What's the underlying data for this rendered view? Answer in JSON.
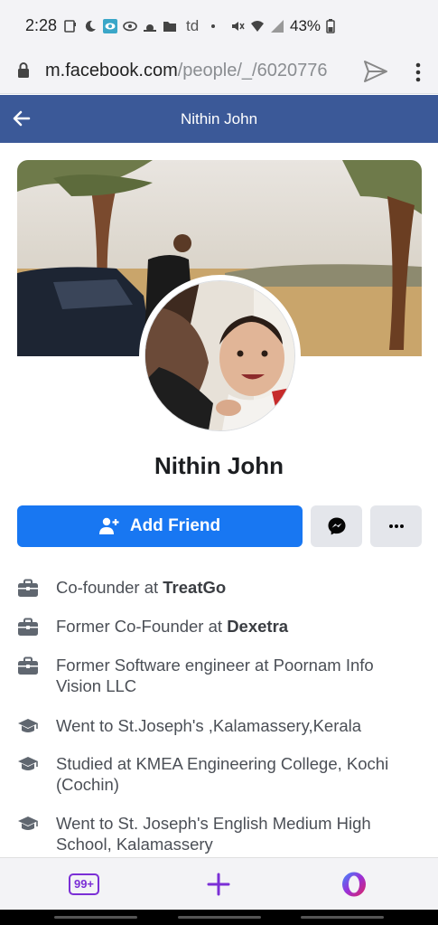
{
  "status_bar": {
    "time": "2:28",
    "carrier_badge": "td",
    "battery": "43%"
  },
  "browser": {
    "url_host": "m.facebook.com",
    "url_path": "/people/_/6020776"
  },
  "header": {
    "title": "Nithin John"
  },
  "profile": {
    "name": "Nithin John",
    "add_friend_label": "Add Friend"
  },
  "info": [
    {
      "icon": "briefcase-icon",
      "prefix": "Co-founder at ",
      "bold": "TreatGo",
      "suffix": ""
    },
    {
      "icon": "briefcase-icon",
      "prefix": "Former Co-Founder at ",
      "bold": "Dexetra",
      "suffix": ""
    },
    {
      "icon": "briefcase-icon",
      "prefix": "Former Software engineer at Poornam Info Vision LLC",
      "bold": "",
      "suffix": ""
    },
    {
      "icon": "graduation-cap-icon",
      "prefix": "Went to St.Joseph's ,Kalamassery,Kerala",
      "bold": "",
      "suffix": ""
    },
    {
      "icon": "graduation-cap-icon",
      "prefix": "Studied at KMEA Engineering College, Kochi (Cochin)",
      "bold": "",
      "suffix": ""
    },
    {
      "icon": "graduation-cap-icon",
      "prefix": "Went to St. Joseph's English Medium High School, Kalamassery",
      "bold": "",
      "suffix": ""
    }
  ],
  "bottom_bar": {
    "tabs_count": "99+"
  },
  "colors": {
    "fb_header": "#3b5998",
    "primary_button": "#1877f2",
    "secondary_button": "#e4e6eb",
    "opera_accent": "#7b2fd6"
  }
}
